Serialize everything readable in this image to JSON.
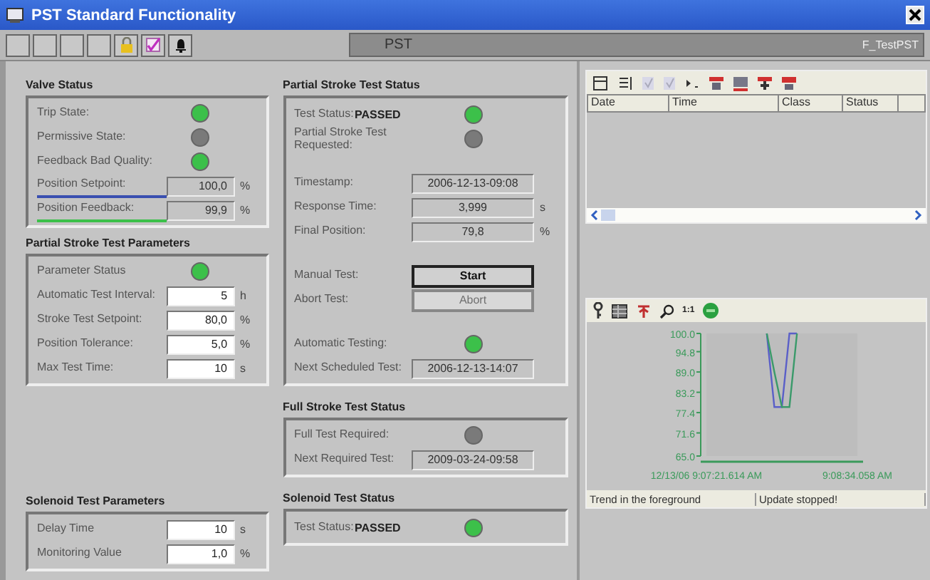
{
  "window": {
    "title": "PST Standard Functionality"
  },
  "toolbar": {
    "tag": "PST",
    "object": "F_TestPST"
  },
  "valve_status": {
    "title": "Valve Status",
    "rows": [
      {
        "kind": "lamp",
        "label": "Trip State:",
        "color": "#3cc04a"
      },
      {
        "kind": "lamp",
        "label": "Permissive State:",
        "color": "#7a7a7a"
      },
      {
        "kind": "lamp",
        "label": "Feedback Bad Quality:",
        "color": "#3cc04a"
      },
      {
        "kind": "trend_value",
        "label": "Position Setpoint:",
        "value": "100,0",
        "unit": "%",
        "color": "#3a4fb0"
      },
      {
        "kind": "trend_value",
        "label": "Position Feedback:",
        "value": "99,9",
        "unit": "%",
        "color": "#3cc04a"
      }
    ]
  },
  "pst_parameters": {
    "title": "Partial Stroke Test Parameters",
    "rows": [
      {
        "kind": "lamp",
        "label": "Parameter Status",
        "color": "#3cc04a"
      },
      {
        "kind": "input",
        "label": "Automatic Test Interval:",
        "value": "5",
        "unit": "h"
      },
      {
        "kind": "input",
        "label": "Stroke Test Setpoint:",
        "value": "80,0",
        "unit": "%"
      },
      {
        "kind": "input",
        "label": "Position Tolerance:",
        "value": "5,0",
        "unit": "%"
      },
      {
        "kind": "input",
        "label": "Max Test Time:",
        "value": "10",
        "unit": "s"
      }
    ]
  },
  "solenoid_parameters": {
    "title": "Solenoid Test Parameters",
    "rows": [
      {
        "kind": "input",
        "label": "Delay Time",
        "value": "10",
        "unit": "s"
      },
      {
        "kind": "input",
        "label": "Monitoring Value",
        "value": "1,0",
        "unit": "%"
      }
    ]
  },
  "pst_status": {
    "title": "Partial Stroke Test Status",
    "sections": [
      [
        {
          "kind": "status",
          "label": "Test Status:",
          "value": "PASSED",
          "color": "#3cc04a"
        },
        {
          "kind": "lamp",
          "label": "Partial Stroke Test Requested:",
          "color": "#7a7a7a"
        }
      ],
      [
        {
          "kind": "readout",
          "label": "Timestamp:",
          "value": "2006-12-13-09:08"
        },
        {
          "kind": "readout",
          "label": "Response Time:",
          "value": "3,999",
          "unit": "s"
        },
        {
          "kind": "readout",
          "label": "Final Position:",
          "value": "79,8",
          "unit": "%"
        }
      ],
      [
        {
          "kind": "button",
          "label": "Manual Test:",
          "value": "Start",
          "disabled": false
        },
        {
          "kind": "button",
          "label": "Abort Test:",
          "value": "Abort",
          "disabled": true
        }
      ],
      [
        {
          "kind": "lamp",
          "label": "Automatic Testing:",
          "color": "#3cc04a"
        },
        {
          "kind": "readout",
          "label": "Next Scheduled Test:",
          "value": "2006-12-13-14:07"
        }
      ]
    ]
  },
  "full_stroke_status": {
    "title": "Full Stroke Test Status",
    "rows": [
      {
        "kind": "lamp",
        "label": "Full Test Required:",
        "color": "#7a7a7a"
      },
      {
        "kind": "readout",
        "label": "Next Required Test:",
        "value": "2009-03-24-09:58"
      }
    ]
  },
  "solenoid_status": {
    "title": "Solenoid Test Status",
    "rows": [
      {
        "kind": "status",
        "label": "Test Status:",
        "value": "PASSED",
        "color": "#3cc04a"
      }
    ]
  },
  "alarm_list": {
    "columns": [
      "Date",
      "Time",
      "Class",
      "Status"
    ]
  },
  "trend": {
    "zoom_label": "1:1",
    "chart_data": {
      "type": "line",
      "categories": [
        "12/13/06 9:07:21.614 AM",
        null,
        null,
        null,
        null,
        null,
        null,
        null,
        null,
        null,
        null,
        null,
        null,
        null,
        null,
        null,
        null,
        null,
        null,
        null,
        "9:08:34.058 AM"
      ],
      "ylim": [
        65,
        100
      ],
      "yticks": [
        {
          "value": 65,
          "label": "65.0"
        },
        {
          "value": 71.6,
          "label": "71.6"
        },
        {
          "value": 77.4,
          "label": "77.4"
        },
        {
          "value": 83.2,
          "label": "83.2"
        },
        {
          "value": 89,
          "label": "89.0"
        },
        {
          "value": 94.8,
          "label": "94.8"
        },
        {
          "value": 100,
          "label": "100.0"
        }
      ],
      "series": [
        {
          "color": "#5a5fc8",
          "values": [
            null,
            null,
            null,
            null,
            null,
            null,
            null,
            null,
            100,
            79,
            79,
            100,
            100,
            null,
            null,
            null,
            null,
            null,
            null,
            null,
            null
          ]
        },
        {
          "color": "#3a9a6a",
          "values": [
            null,
            null,
            null,
            null,
            null,
            null,
            null,
            null,
            100,
            89,
            79,
            79,
            100,
            null,
            null,
            null,
            null,
            null,
            null,
            null,
            null
          ]
        }
      ]
    },
    "status_bar": [
      "Trend in the foreground",
      "Update stopped!"
    ]
  }
}
